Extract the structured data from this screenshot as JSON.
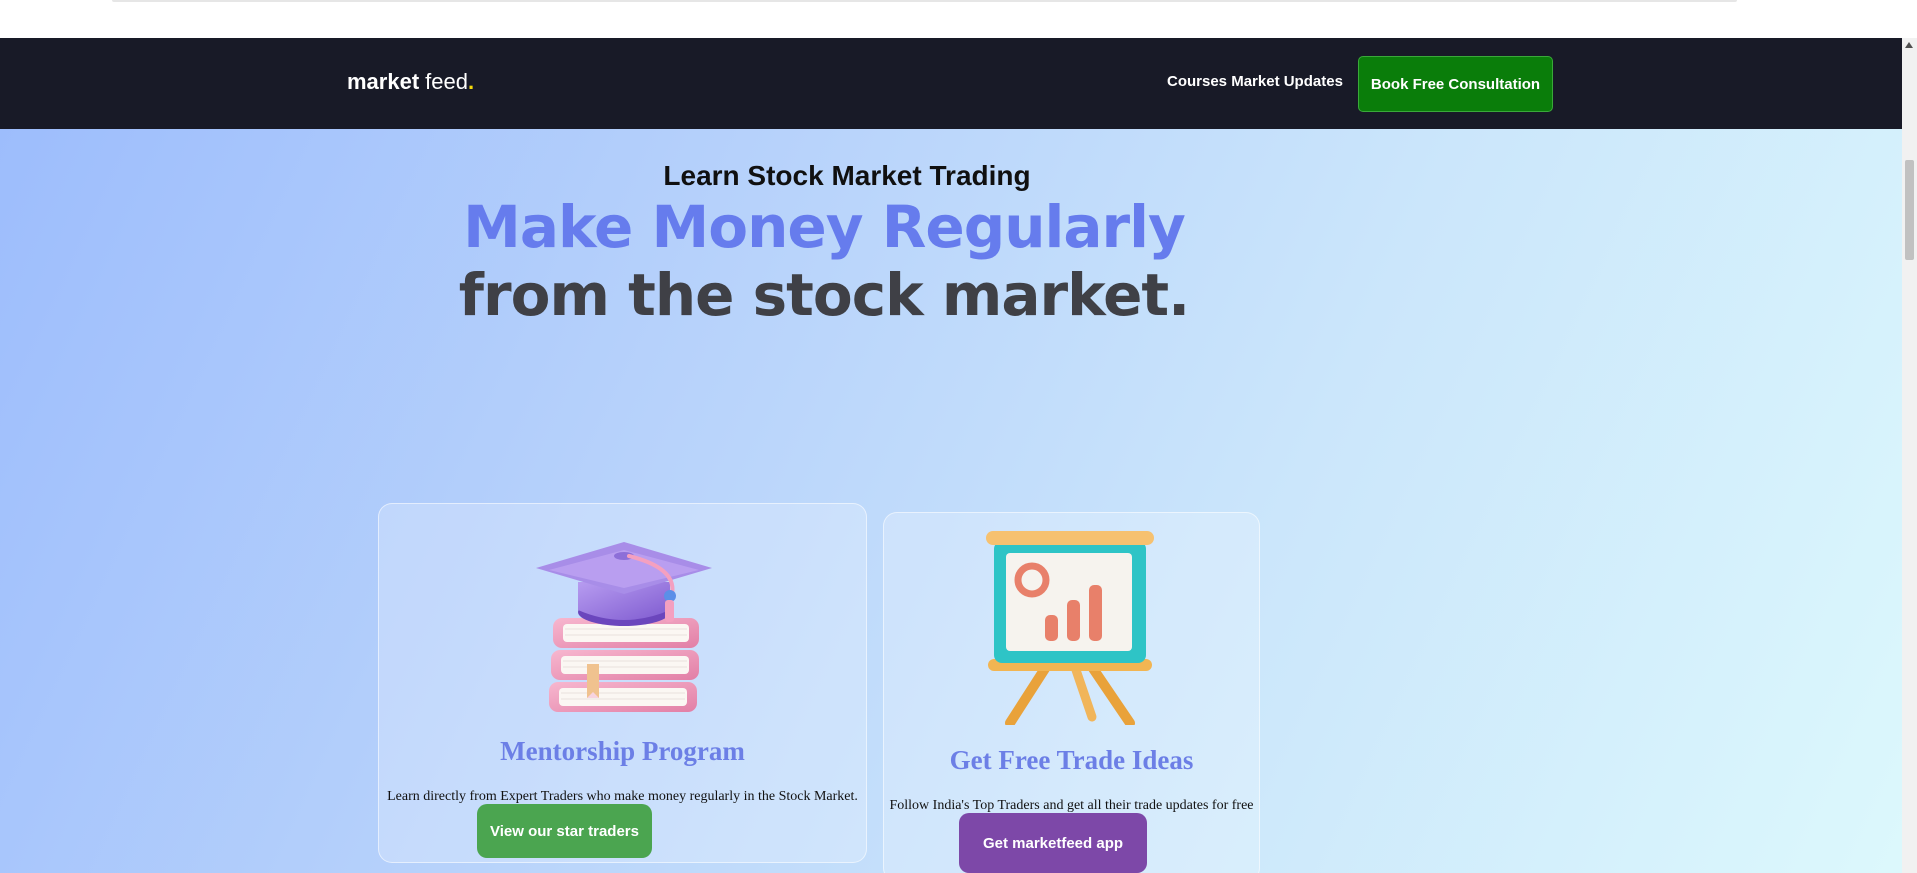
{
  "nav": {
    "logo_part1": "market",
    "logo_part2": "feed",
    "logo_dot": ".",
    "links": [
      "Courses",
      "Market Updates"
    ],
    "cta_label": "Book Free Consultation"
  },
  "hero": {
    "eyebrow": "Learn Stock Market Trading",
    "headline_line1": "Make Money Regularly",
    "headline_line2": "from the stock market."
  },
  "cards": [
    {
      "title": "Mentorship Program",
      "description": "Learn directly from Expert Traders who make money regularly in the Stock Market.",
      "button_label": "View our star traders",
      "icon": "graduation-cap-books-icon"
    },
    {
      "title": "Get Free Trade Ideas",
      "description": "Follow India's Top Traders and get all their trade updates for free",
      "button_label": "Get marketfeed app",
      "icon": "presentation-board-chart-icon"
    }
  ],
  "colors": {
    "nav_bg": "#181a27",
    "cta_green": "#0a7d0a",
    "headline_blue": "#667ced",
    "headline_dark": "#3f4046",
    "btn_green": "#4ba550",
    "btn_purple": "#7d48a8",
    "logo_dot": "#f5d90a"
  }
}
